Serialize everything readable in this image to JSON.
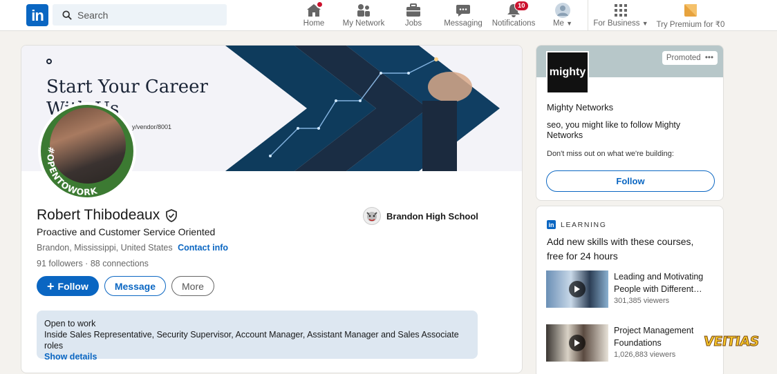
{
  "nav": {
    "search_placeholder": "Search",
    "items": [
      {
        "label": "Home",
        "icon": "home-icon"
      },
      {
        "label": "My Network",
        "icon": "network-icon"
      },
      {
        "label": "Jobs",
        "icon": "briefcase-icon"
      },
      {
        "label": "Messaging",
        "icon": "messaging-icon"
      },
      {
        "label": "Notifications",
        "icon": "bell-icon",
        "badge": "10"
      },
      {
        "label": "Me",
        "icon": "avatar-icon"
      },
      {
        "label": "For Business",
        "icon": "grid-icon"
      },
      {
        "label": "Try Premium for ₹0",
        "icon": "premium-icon"
      }
    ]
  },
  "banner": {
    "title": "Start Your Career With Us",
    "small_text": "y/vendor/8001"
  },
  "profile": {
    "name": "Robert Thibodeaux",
    "headline": "Proactive and Customer Service Oriented",
    "location": "Brandon, Mississippi, United States",
    "contact_label": "Contact info",
    "followers": "91 followers",
    "connections": "88 connections",
    "open_to_work_badge": "#OPENTOWORK",
    "school": "Brandon High School",
    "follow_label": "Follow",
    "message_label": "Message",
    "more_label": "More",
    "open_to_work": {
      "title": "Open to work",
      "roles": "Inside Sales Representative, Security Supervisor, Account Manager, Assistant Manager and Sales Associate roles",
      "details_label": "Show details"
    }
  },
  "ad": {
    "logo_text": "mighty",
    "promoted_label": "Promoted",
    "company": "Mighty Networks",
    "message": "seo, you might like to follow Mighty Networks",
    "sub": "Don't miss out on what we're building:",
    "follow_label": "Follow"
  },
  "learning": {
    "header": "LEARNING",
    "title": "Add new skills with these courses, free for 24 hours",
    "courses": [
      {
        "title": "Leading and Motivating People with Different…",
        "views": "301,385 viewers"
      },
      {
        "title": "Project Management Foundations",
        "views": "1,026,883 viewers"
      }
    ]
  },
  "watermark": "VEITIAS",
  "colors": {
    "brand": "#0a66c2",
    "badge": "#cb112d",
    "opentowork": "#3c7a32"
  }
}
